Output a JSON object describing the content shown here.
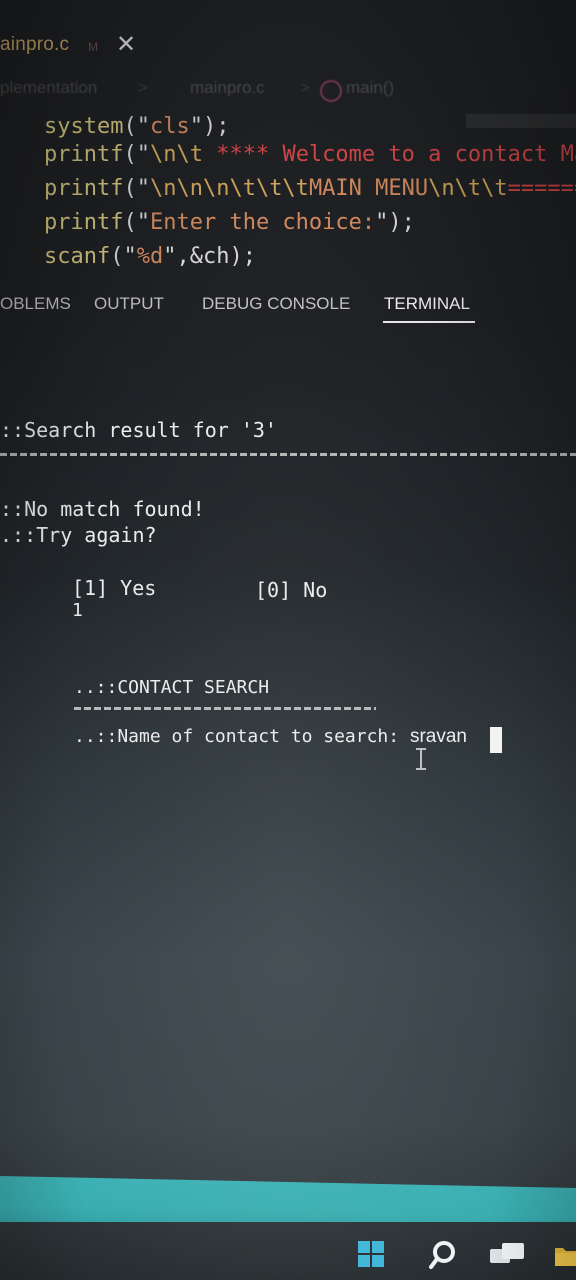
{
  "editor": {
    "tab_file": "ainpro.c",
    "tab_dirty": "M",
    "close_glyph": "✕",
    "breadcrumb": {
      "part1": "plementation",
      "sep": ">",
      "file": "mainpro.c",
      "symbol": "main()"
    },
    "code_lines": [
      {
        "fn": "system",
        "open": "(\"",
        "str": "cls",
        "close": "\");",
        "rest": ""
      },
      {
        "fn": "printf",
        "open": "(\"",
        "esc": "\\n\\t ",
        "red": "**** Welcome to a contact Ma",
        "close": ""
      },
      {
        "fn": "printf",
        "open": "(\"",
        "esc": "\\n\\n\\n\\t\\t\\t",
        "str": "MAIN MENU",
        "esc2": "\\n\\t\\t",
        "red": "======="
      },
      {
        "fn": "printf",
        "open": "(\"",
        "str": "Enter the choice:",
        "close": "\");"
      },
      {
        "fn": "scanf",
        "open": "(\"",
        "str": "%d",
        "close": "\",&ch);"
      }
    ]
  },
  "panel": {
    "tabs": [
      "OBLEMS",
      "OUTPUT",
      "DEBUG CONSOLE",
      "TERMINAL"
    ],
    "active": "TERMINAL"
  },
  "terminal": {
    "search_result": "::Search result for '3'",
    "no_match": "::No match found!",
    "try_again": ".::Try again?",
    "opt_yes": "[1] Yes",
    "opt_no": "[0] No",
    "input_choice": "1",
    "contact_search": "..::CONTACT SEARCH",
    "prompt": "..::Name of contact to search: ",
    "typed": "sravan"
  },
  "colors": {
    "taskbar_accent": "#3cb1b4",
    "terminal_text": "#ececec",
    "code_function": "#d3c57f",
    "code_string": "#d0895e",
    "code_highlight": "#d4474b"
  },
  "icons": [
    "close-icon",
    "symbol-icon",
    "windows-start-icon",
    "search-icon",
    "task-view-icon",
    "file-explorer-icon"
  ]
}
